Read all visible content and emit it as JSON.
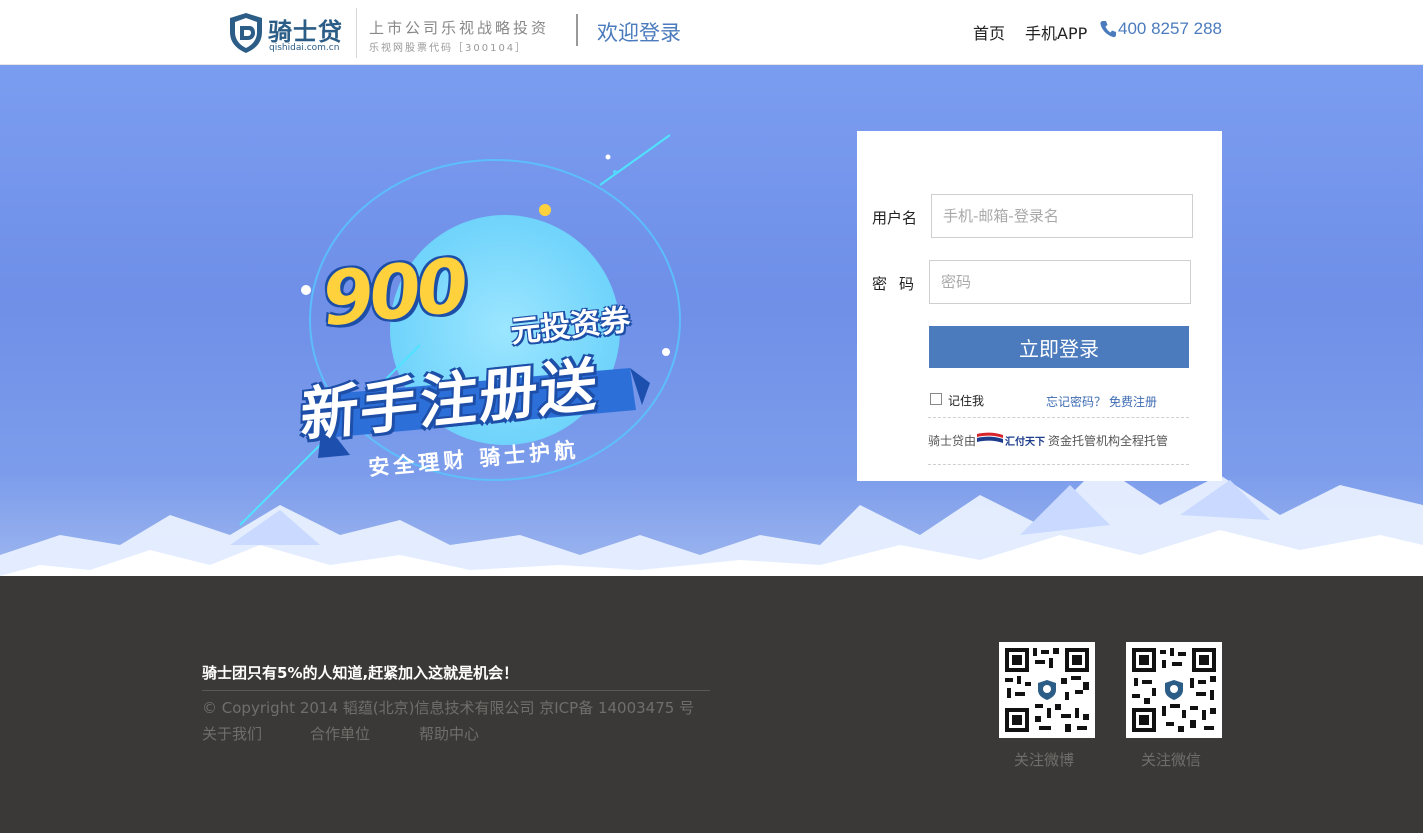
{
  "header": {
    "logo_name": "骑士贷",
    "logo_domain": "qishidai.com.cn",
    "slogan_line1": "上市公司乐视战略投资",
    "slogan_line2": "乐视网股票代码［300104］",
    "welcome": "欢迎登录",
    "nav": {
      "home": "首页",
      "app": "手机APP"
    },
    "phone": "400 8257 288"
  },
  "banner": {
    "amount": "900",
    "coupon": "元投资券",
    "headline": "新手注册送",
    "ribbon": "安全理财 骑士护航"
  },
  "login": {
    "username_label": "用户名",
    "username_placeholder": "手机-邮箱-登录名",
    "username_value": "",
    "password_label": "密码",
    "password_placeholder": "密码",
    "password_value": "",
    "submit_label": "立即登录",
    "remember_label": "记住我",
    "remember_checked": false,
    "forgot_label": "忘记密码？",
    "register_label": "免费注册",
    "custody_prefix": "骑士贷由",
    "custody_brand": "汇付天下",
    "custody_suffix": "资金托管机构全程托管"
  },
  "footer": {
    "tagline": "骑士团只有5%的人知道,赶紧加入这就是机会！",
    "copyright": "© Copyright 2014 韬蕴(北京)信息技术有限公司 京ICP备 14003475 号",
    "links": [
      "关于我们",
      "合作单位",
      "帮助中心"
    ],
    "qr_weibo_label": "关注微博",
    "qr_wechat_label": "关注微信"
  },
  "colors": {
    "brand_blue": "#4b7bbd",
    "logo_blue": "#2c5d86",
    "banner_blue": "#7393ea",
    "coupon_yellow": "#ffd23d",
    "footer_bg": "#3a3937"
  },
  "icons": [
    "shield-logo-icon",
    "phone-icon",
    "huifu-logo-icon",
    "qr-code-weibo",
    "qr-code-wechat"
  ]
}
